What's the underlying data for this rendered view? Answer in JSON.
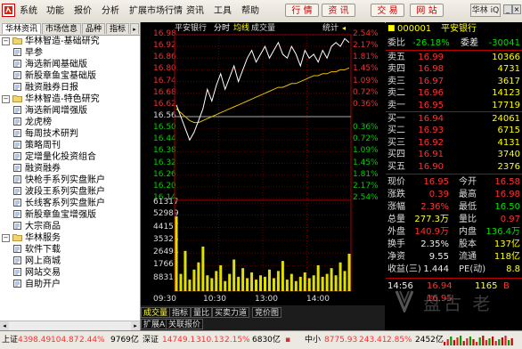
{
  "menu": [
    "系统",
    "功能",
    "报价",
    "分析",
    "扩展市场行情",
    "资讯",
    "工具",
    "帮助"
  ],
  "toolbar_buttons": [
    "行 情",
    "资 讯",
    "交 易",
    "网 站"
  ],
  "brand": "华林 iQ",
  "nav": {
    "tabs": [
      "华林资讯",
      "市场信息",
      "品种",
      "指标"
    ],
    "groups": [
      {
        "title": "华林智造-基础研究",
        "items": [
          "早参",
          "海选新闻基础版",
          "新股章鱼宝基础版",
          "融资融券日报"
        ]
      },
      {
        "title": "华林智造-特色研究",
        "items": [
          "海选新闻增强版",
          "龙虎榜",
          "每周技术研判",
          "策略周刊",
          "定增量化投资组合",
          "融资融券",
          "快枪手系列实盘账户",
          "波段王系列实盘账户",
          "长线客系列实盘账户",
          "新股章鱼宝增强版",
          "大宗商品"
        ]
      },
      {
        "title": "华林服务",
        "items": [
          "软件下载",
          "网上商城",
          "网站交易",
          "自助开户"
        ]
      }
    ]
  },
  "chart": {
    "header": {
      "name": "平安银行",
      "mode": "分时",
      "avg_label": "均线",
      "vol_label": "成交量",
      "right": "统计"
    },
    "price_ticks": [
      "16.98",
      "16.92",
      "16.86",
      "16.80",
      "16.74",
      "16.68",
      "16.62",
      "16.56",
      "16.50",
      "16.44",
      "16.38",
      "16.32",
      "16.26",
      "16.20",
      "16.14"
    ],
    "pct_ticks": [
      "2.54%",
      "2.17%",
      "1.81%",
      "1.45%",
      "1.09%",
      "0.72%",
      "0.36%",
      "0.36%",
      "0.72%",
      "1.09%",
      "1.45%",
      "1.81%",
      "2.17%",
      "2.54%"
    ],
    "volume_ticks": [
      "61317",
      "52989",
      "44157",
      "35325",
      "26494",
      "17662",
      "8831"
    ],
    "time_ticks": [
      "09:30",
      "10:30",
      "13:00",
      "14:00"
    ],
    "tabs": [
      "成交量",
      "指标",
      "量比",
      "买卖力道",
      "竞价图"
    ],
    "tabs2": [
      "扩展A",
      "关联报价"
    ],
    "series": {
      "price": [
        16.62,
        16.56,
        16.5,
        16.44,
        16.48,
        16.54,
        16.6,
        16.7,
        16.64,
        16.72,
        16.78,
        16.7,
        16.76,
        16.82,
        16.74,
        16.8,
        16.86,
        16.9,
        16.84,
        16.88,
        16.92,
        16.86,
        16.9,
        16.94,
        16.88,
        16.86,
        16.92,
        16.88,
        16.82,
        16.9,
        16.86,
        16.88,
        16.84,
        16.9,
        16.86,
        16.92,
        16.94,
        16.92,
        16.96,
        16.94
      ],
      "avg": [
        16.6,
        16.58,
        16.56,
        16.54,
        16.53,
        16.53,
        16.54,
        16.55,
        16.56,
        16.57,
        16.58,
        16.59,
        16.6,
        16.61,
        16.62,
        16.63,
        16.64,
        16.65,
        16.66,
        16.67,
        16.68,
        16.69,
        16.7,
        16.71,
        16.71,
        16.72,
        16.73,
        16.73,
        16.74,
        16.75,
        16.76,
        16.77,
        16.77,
        16.78,
        16.78,
        16.79,
        16.79,
        16.8,
        16.8,
        16.81
      ],
      "volume": [
        52000,
        12000,
        28000,
        8000,
        15000,
        20000,
        31000,
        11000,
        9000,
        14000,
        18000,
        7000,
        12000,
        22000,
        10000,
        16000,
        9000,
        13000,
        8000,
        11000,
        10000,
        15000,
        9000,
        14000,
        21000,
        8000,
        12000,
        7000,
        10000,
        13000,
        9000,
        11000,
        18000,
        10000,
        12000,
        16000,
        11000,
        20000,
        14000,
        26000
      ]
    }
  },
  "quote": {
    "code": "000001",
    "name": "平安银行",
    "ratio_label": "委比",
    "ratio": "-26.18%",
    "diff_label": "委差",
    "diff": "-30041",
    "asks": [
      {
        "label": "卖五",
        "price": "16.99",
        "vol": "10366"
      },
      {
        "label": "卖四",
        "price": "16.98",
        "vol": "4731"
      },
      {
        "label": "卖三",
        "price": "16.97",
        "vol": "3617"
      },
      {
        "label": "卖二",
        "price": "16.96",
        "vol": "14123"
      },
      {
        "label": "卖一",
        "price": "16.95",
        "vol": "17719"
      }
    ],
    "bids": [
      {
        "label": "买一",
        "price": "16.94",
        "vol": "24061"
      },
      {
        "label": "买二",
        "price": "16.93",
        "vol": "6715"
      },
      {
        "label": "买三",
        "price": "16.92",
        "vol": "4131"
      },
      {
        "label": "买四",
        "price": "16.91",
        "vol": "3740"
      },
      {
        "label": "买五",
        "price": "16.90",
        "vol": "2376"
      }
    ],
    "stats": [
      {
        "l1": "现价",
        "v1": "16.95",
        "l2": "今开",
        "v2": "16.58"
      },
      {
        "l1": "涨跌",
        "v1": "0.39",
        "l2": "最高",
        "v2": "16.98"
      },
      {
        "l1": "涨幅",
        "v1": "2.36%",
        "l2": "最低",
        "v2": "16.50"
      },
      {
        "l1": "总量",
        "v1": "277.3万",
        "l2": "量比",
        "v2": "0.97"
      },
      {
        "l1": "外盘",
        "v1": "140.9万",
        "l2": "内盘",
        "v2": "136.4万"
      },
      {
        "l1": "换手",
        "v1": "2.35%",
        "l2": "股本",
        "v2": "137亿"
      },
      {
        "l1": "净资",
        "v1": "9.55",
        "l2": "流通",
        "v2": "118亿"
      },
      {
        "l1": "收益(三)",
        "v1": "1.444",
        "l2": "PE(动)",
        "v2": "8.8"
      }
    ],
    "ticks": [
      {
        "time": "14:56",
        "price": "16.94",
        "vol": "1165",
        "dir": "B"
      },
      {
        "time": "",
        "price": "16.95",
        "vol": "",
        "dir": ""
      },
      {
        "time": "",
        "price": "",
        "vol": "",
        "dir": ""
      }
    ],
    "watermark": "盘古 老"
  },
  "status": {
    "sh_label": "上证",
    "sh_val": "4398.49",
    "sh_chg": "104.87",
    "sh_pct": "2.44%",
    "sh_amt": "9769亿",
    "sz_label": "深证",
    "sz_val": "14749.1",
    "sz_chg": "310.13",
    "sz_pct": "2.15%",
    "sz_amt": "6830亿",
    "zx_label": "中小",
    "zx_val": "8775.93",
    "zx_chg": "243.41",
    "zx_pct": "2.85%",
    "zx_amt": "2452亿"
  }
}
